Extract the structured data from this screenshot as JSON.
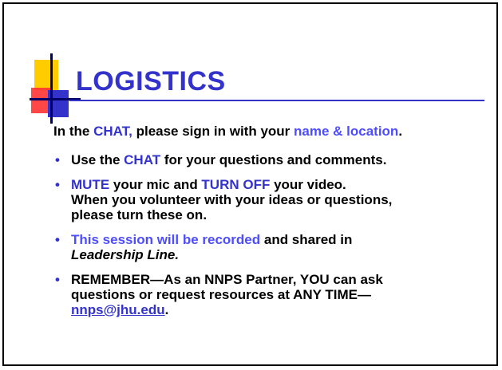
{
  "slide": {
    "title": "LOGISTICS",
    "intro": {
      "t1": "In the ",
      "chat": "CHAT,",
      "t2": " please sign in with your ",
      "name_loc": "name & location",
      "t3": "."
    },
    "bullets": [
      {
        "t1": "Use the ",
        "chat": "CHAT",
        "t2": " for your questions and comments."
      },
      {
        "mute": "MUTE",
        "t1": " your mic and ",
        "turn_off": "TURN OFF",
        "t2": " your video.",
        "line2": "When you volunteer with your ideas or questions,",
        "line3": "please turn these on."
      },
      {
        "recorded": "This session will be recorded",
        "t1": " and shared in",
        "leadership": "Leadership Line."
      },
      {
        "t1": "REMEMBER—As an NNPS Partner, YOU can ask",
        "t2": "questions or request resources at ANY TIME—",
        "email": "nnps@jhu.edu",
        "t3": "."
      }
    ],
    "bullet_glyph": "•"
  },
  "colors": {
    "accent_blue": "#3333cc",
    "logo_yellow": "#ffcc00",
    "logo_red": "#ff3333",
    "logo_blue": "#3333cc"
  }
}
